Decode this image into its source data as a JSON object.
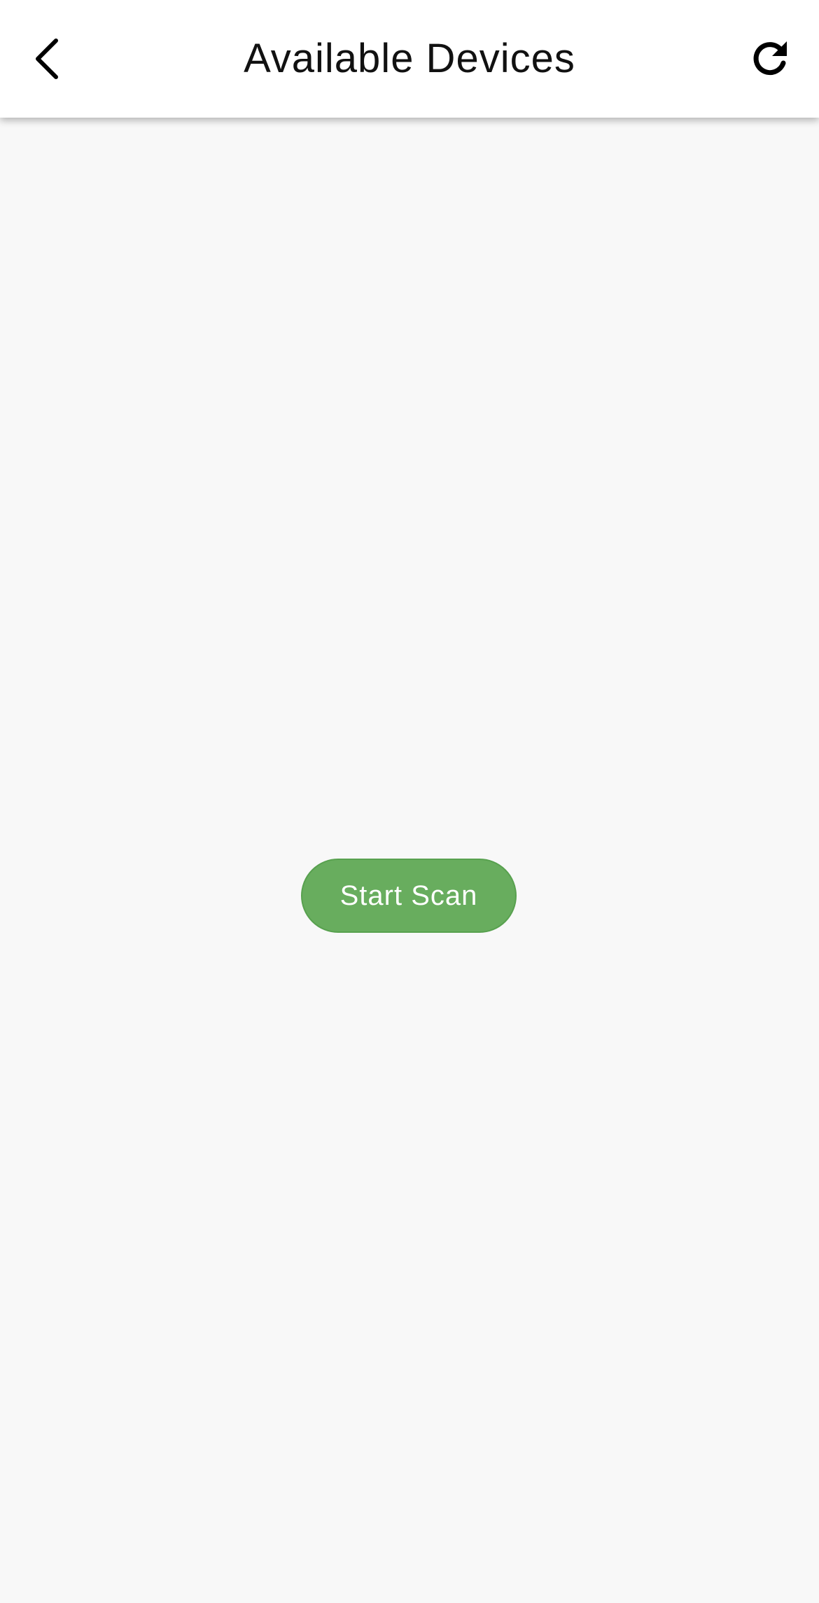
{
  "header": {
    "title": "Available Devices",
    "back_icon": "chevron-left-icon",
    "refresh_icon": "refresh-icon",
    "background_color": "#ffffff"
  },
  "main": {
    "background_color": "#f8f8f8",
    "scan_button": {
      "label": "Start Scan",
      "color": "#68ad5e"
    }
  }
}
